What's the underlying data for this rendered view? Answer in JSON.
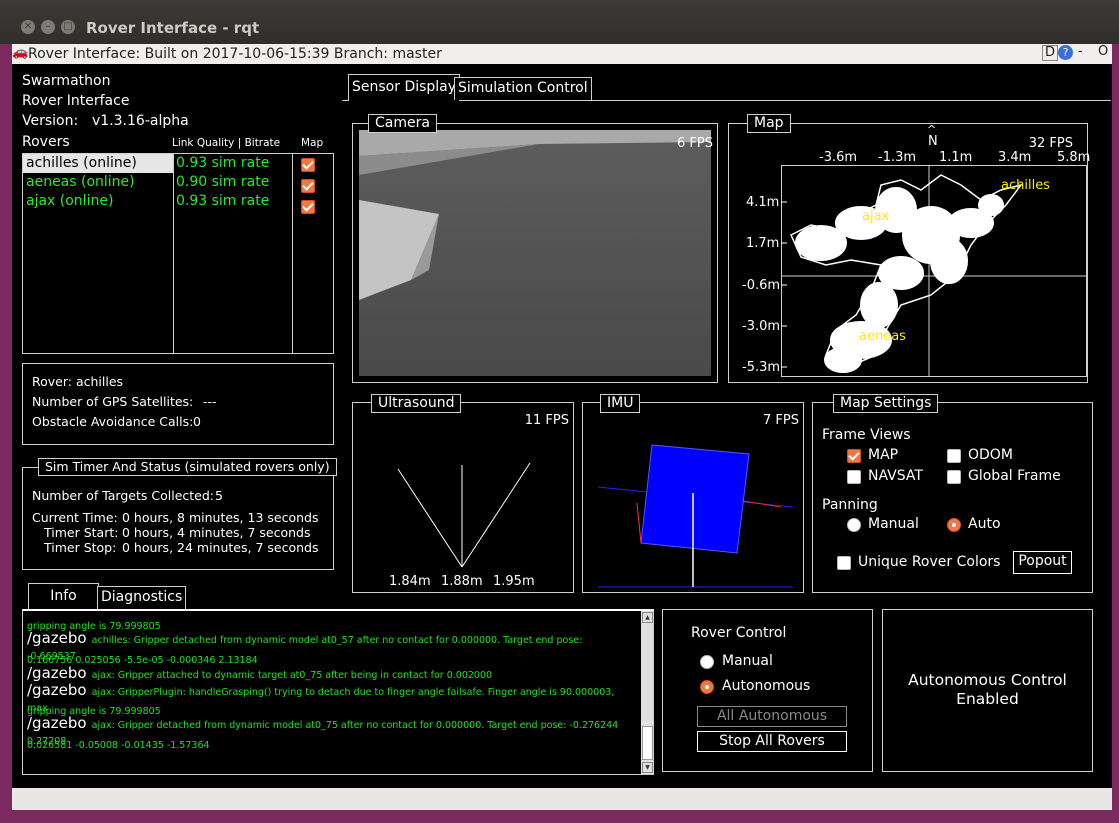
{
  "window": {
    "title": "Rover Interface - rqt",
    "subtitle": "Rover Interface: Built on 2017-10-06-15:39 Branch: master",
    "corner_buttons": [
      "D",
      "?",
      "-",
      "O"
    ]
  },
  "info_panel": {
    "line1": "Swarmathon",
    "line2": "Rover Interface",
    "version_label": "Version:",
    "version_value": "v1.3.16-alpha",
    "rovers_label": "Rovers",
    "link_quality_header": "Link Quality | Bitrate",
    "map_header": "Map",
    "rovers": [
      {
        "name": "achilles (online)",
        "link": "0.93 sim rate",
        "map": true,
        "selected": true
      },
      {
        "name": "aeneas (online)",
        "link": "0.90 sim rate",
        "map": true,
        "selected": false
      },
      {
        "name": "ajax (online)",
        "link": "0.93 sim rate",
        "map": true,
        "selected": false
      }
    ]
  },
  "rover_status": {
    "rover": "Rover: achilles",
    "gps_label": "Number of GPS Satellites:",
    "gps_value": "---",
    "obstacle_label": "Obstacle Avoidance Calls:",
    "obstacle_value": "0"
  },
  "sim_timer": {
    "title": "Sim Timer And Status (simulated rovers only)",
    "targets_label": "Number of Targets Collected:",
    "targets_value": "5",
    "current_label": "Current Time:",
    "current_value": "0 hours, 8 minutes, 13 seconds",
    "start_label": "Timer Start:",
    "start_value": "0 hours, 4 minutes, 7 seconds",
    "stop_label": "Timer Stop:",
    "stop_value": "0 hours, 24 minutes, 7 seconds"
  },
  "tabs": {
    "sensor": "Sensor Display",
    "sim": "Simulation Control"
  },
  "camera": {
    "title": "Camera",
    "fps": "6 FPS"
  },
  "map": {
    "title": "Map",
    "fps": "32 FPS",
    "north": "N",
    "x_ticks": [
      "-3.6m",
      "-1.3m",
      "1.1m",
      "3.4m",
      "5.8m"
    ],
    "y_ticks": [
      "4.1m",
      "1.7m",
      "-0.6m",
      "-3.0m",
      "-5.3m"
    ],
    "labels": [
      "achilles",
      "ajax",
      "aeneas"
    ]
  },
  "ultrasound": {
    "title": "Ultrasound",
    "fps": "11 FPS",
    "left": "1.84m",
    "center": "1.88m",
    "right": "1.95m"
  },
  "imu": {
    "title": "IMU",
    "fps": "7 FPS"
  },
  "map_settings": {
    "title": "Map Settings",
    "frame_views": "Frame Views",
    "map": "MAP",
    "odom": "ODOM",
    "navsat": "NAVSAT",
    "global_frame": "Global Frame",
    "panning": "Panning",
    "manual": "Manual",
    "auto": "Auto",
    "unique_colors": "Unique Rover Colors",
    "popout": "Popout"
  },
  "log_tabs": {
    "info": "Info",
    "diagnostics": "Diagnostics"
  },
  "log": [
    {
      "tag": "",
      "text": "gripping angle is 79.999805"
    },
    {
      "tag": "/gazebo",
      "text": "achilles: Gripper detached from dynamic model at0_57 after no contact for 0.000000. Target end pose: -0.669537"
    },
    {
      "tag": "",
      "text": "0.166756 0.025056 -5.5e-05 -0.000346 2.13184"
    },
    {
      "tag": "/gazebo",
      "text": "ajax: Gripper attached to dynamic target at0_75 after being in contact for 0.002000"
    },
    {
      "tag": "/gazebo",
      "text": "ajax: GripperPlugin: handleGrasping() trying to detach due to finger angle failsafe. Finger angle is 90.000003, max"
    },
    {
      "tag": "",
      "text": "gripping angle is 79.999805"
    },
    {
      "tag": "/gazebo",
      "text": "ajax: Gripper detached from dynamic model at0_75 after no contact for 0.000000. Target end pose: -0.276244 0.27208"
    },
    {
      "tag": "",
      "text": "0.026581 -0.05008 -0.01435 -1.57364"
    }
  ],
  "rover_control": {
    "title": "Rover Control",
    "manual": "Manual",
    "autonomous": "Autonomous",
    "all_autonomous": "All Autonomous",
    "stop_all": "Stop All Rovers"
  },
  "status_message": {
    "line1": "Autonomous Control",
    "line2": "Enabled"
  }
}
